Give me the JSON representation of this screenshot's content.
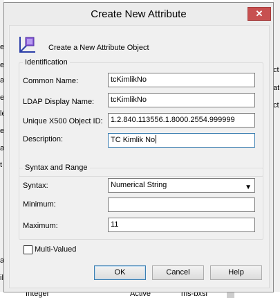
{
  "background": {
    "left_fragments": [
      "e",
      "e",
      "a",
      "e",
      "le",
      "e",
      "a",
      "t",
      "a",
      "il"
    ],
    "right_fragments": [
      "ct",
      "at",
      "ct"
    ],
    "bottom_texts": [
      "Integer",
      "Active",
      "ms-bxsl"
    ]
  },
  "dialog": {
    "title": "Create New Attribute",
    "close_label": "✕",
    "header_text": "Create a New Attribute Object",
    "identification": {
      "group_title": "Identification",
      "common_name_label": "Common Name:",
      "common_name_value": "tcKimlikNo",
      "ldap_label": "LDAP Display Name:",
      "ldap_value": "tcKimlikNo",
      "x500_label": "Unique X500 Object ID:",
      "x500_value": "1.2.840.113556.1.8000.2554.999999",
      "description_label": "Description:",
      "description_value": "TC Kimlik No"
    },
    "syntax_range": {
      "group_title": "Syntax and Range",
      "syntax_label": "Syntax:",
      "syntax_value": "Numerical String",
      "minimum_label": "Minimum:",
      "minimum_value": "",
      "maximum_label": "Maximum:",
      "maximum_value": "11"
    },
    "multi_valued_label": "Multi-Valued",
    "multi_valued_checked": false,
    "buttons": {
      "ok": "OK",
      "cancel": "Cancel",
      "help": "Help"
    }
  },
  "colors": {
    "close_button": "#c75050",
    "focus_border": "#3c7fb1",
    "icon_blue": "#2b3ea8",
    "icon_purple": "#8a5ad6"
  }
}
